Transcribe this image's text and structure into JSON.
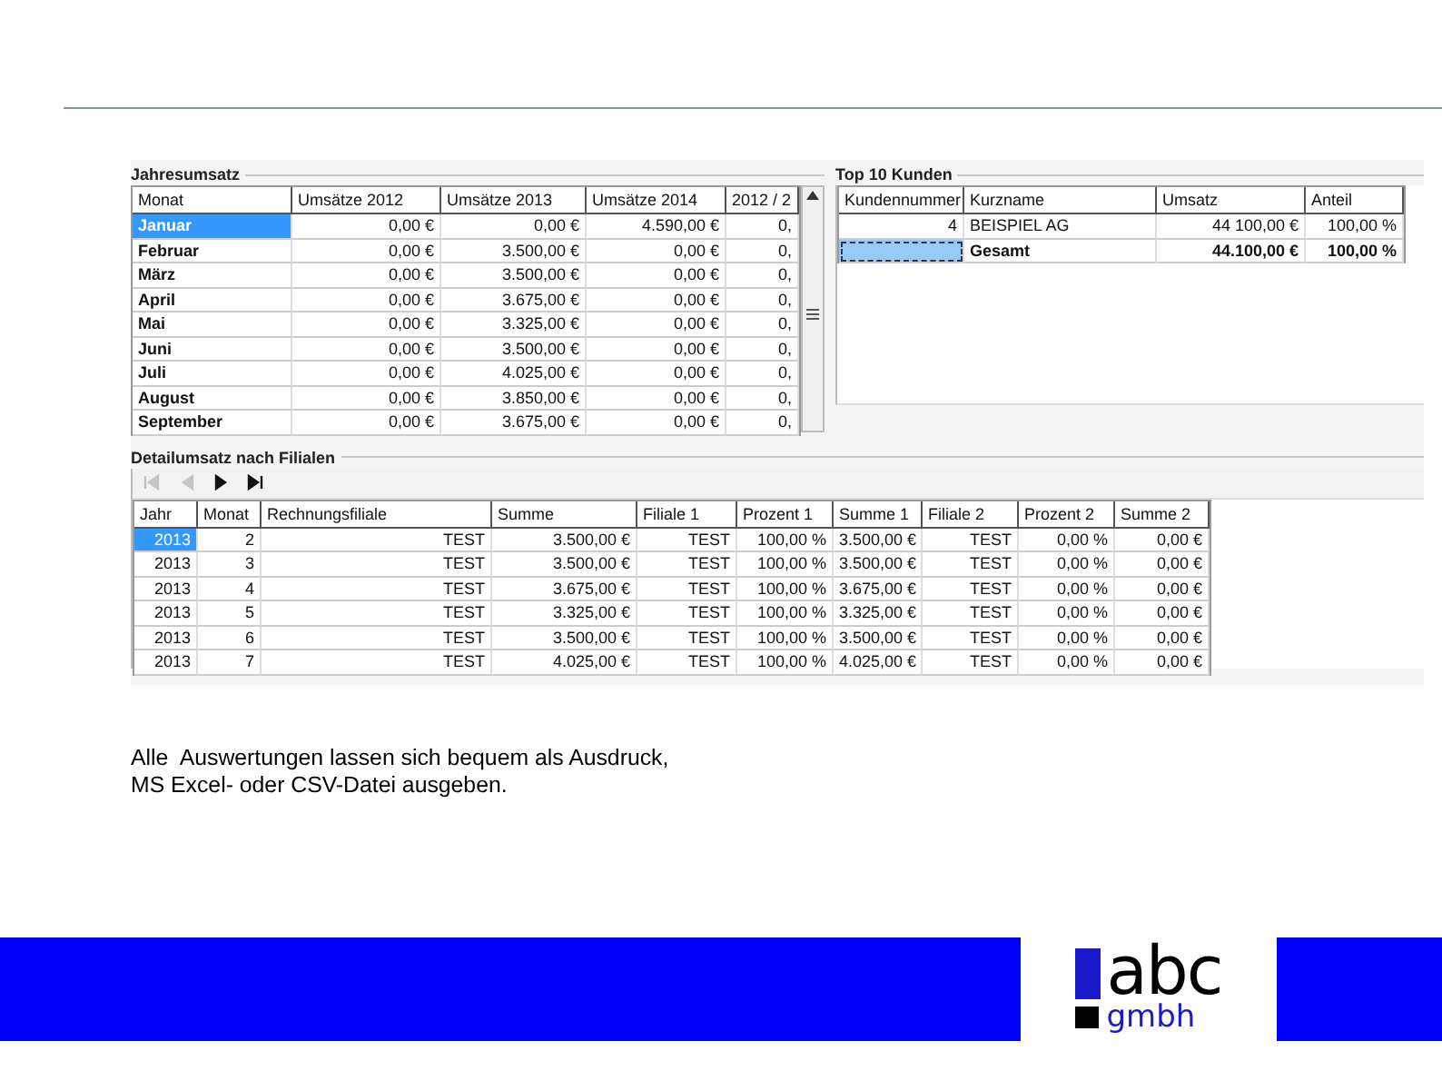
{
  "yearly_sales": {
    "title": "Jahresumsatz",
    "columns": [
      "Monat",
      "Umsätze 2012",
      "Umsätze 2013",
      "Umsätze 2014",
      "2012 / 2"
    ],
    "rows": [
      {
        "cells": [
          "Januar",
          "0,00 €",
          "0,00 €",
          "4.590,00 €",
          "0,"
        ],
        "selected": true
      },
      {
        "cells": [
          "Februar",
          "0,00 €",
          "3.500,00 €",
          "0,00 €",
          "0,"
        ],
        "selected": false
      },
      {
        "cells": [
          "März",
          "0,00 €",
          "3.500,00 €",
          "0,00 €",
          "0,"
        ],
        "selected": false
      },
      {
        "cells": [
          "April",
          "0,00 €",
          "3.675,00 €",
          "0,00 €",
          "0,"
        ],
        "selected": false
      },
      {
        "cells": [
          "Mai",
          "0,00 €",
          "3.325,00 €",
          "0,00 €",
          "0,"
        ],
        "selected": false
      },
      {
        "cells": [
          "Juni",
          "0,00 €",
          "3.500,00 €",
          "0,00 €",
          "0,"
        ],
        "selected": false
      },
      {
        "cells": [
          "Juli",
          "0,00 €",
          "4.025,00 €",
          "0,00 €",
          "0,"
        ],
        "selected": false
      },
      {
        "cells": [
          "August",
          "0,00 €",
          "3.850,00 €",
          "0,00 €",
          "0,"
        ],
        "selected": false
      },
      {
        "cells": [
          "September",
          "0,00 €",
          "3.675,00 €",
          "0,00 €",
          "0,"
        ],
        "selected": false
      }
    ]
  },
  "top_customers": {
    "title": "Top 10 Kunden",
    "columns": [
      "Kundennummer",
      "Kurzname",
      "Umsatz",
      "Anteil"
    ],
    "rows": [
      {
        "kind": "item",
        "cells": [
          "4",
          "BEISPIEL AG",
          "44 100,00 €",
          "100,00 %"
        ],
        "selected": false
      },
      {
        "kind": "total",
        "cells": [
          "",
          "Gesamt",
          "44.100,00 €",
          "100,00 %"
        ],
        "selected": true
      }
    ]
  },
  "branch_detail": {
    "title": "Detailumsatz nach Filialen",
    "pager": [
      {
        "kind": "first",
        "disabled": true
      },
      {
        "kind": "prev",
        "disabled": true
      },
      {
        "kind": "next",
        "disabled": false
      },
      {
        "kind": "last",
        "disabled": false
      }
    ],
    "columns": [
      "Jahr",
      "Monat",
      "Rechnungsfiliale",
      "Summe",
      "Filiale 1",
      "Prozent 1",
      "Summe 1",
      "Filiale 2",
      "Prozent 2",
      "Summe 2"
    ],
    "rows": [
      {
        "cells": [
          "2013",
          "2",
          "TEST",
          "3.500,00 €",
          "TEST",
          "100,00 %",
          "3.500,00 €",
          "TEST",
          "0,00 %",
          "0,00 €"
        ],
        "selected": true
      },
      {
        "cells": [
          "2013",
          "3",
          "TEST",
          "3.500,00 €",
          "TEST",
          "100,00 %",
          "3.500,00 €",
          "TEST",
          "0,00 %",
          "0,00 €"
        ],
        "selected": false
      },
      {
        "cells": [
          "2013",
          "4",
          "TEST",
          "3.675,00 €",
          "TEST",
          "100,00 %",
          "3.675,00 €",
          "TEST",
          "0,00 %",
          "0,00 €"
        ],
        "selected": false
      },
      {
        "cells": [
          "2013",
          "5",
          "TEST",
          "3.325,00 €",
          "TEST",
          "100,00 %",
          "3.325,00 €",
          "TEST",
          "0,00 %",
          "0,00 €"
        ],
        "selected": false
      },
      {
        "cells": [
          "2013",
          "6",
          "TEST",
          "3.500,00 €",
          "TEST",
          "100,00 %",
          "3.500,00 €",
          "TEST",
          "0,00 %",
          "0,00 €"
        ],
        "selected": false
      },
      {
        "cells": [
          "2013",
          "7",
          "TEST",
          "4.025,00 €",
          "TEST",
          "100,00 %",
          "4.025,00 €",
          "TEST",
          "0,00 %",
          "0,00 €"
        ],
        "selected": false
      }
    ]
  },
  "caption": "Alle  Auswertungen lassen sich bequem als Ausdruck,\nMS Excel- oder CSV-Datei ausgeben.",
  "logo": {
    "top": "abc",
    "bottom": "gmbh"
  }
}
